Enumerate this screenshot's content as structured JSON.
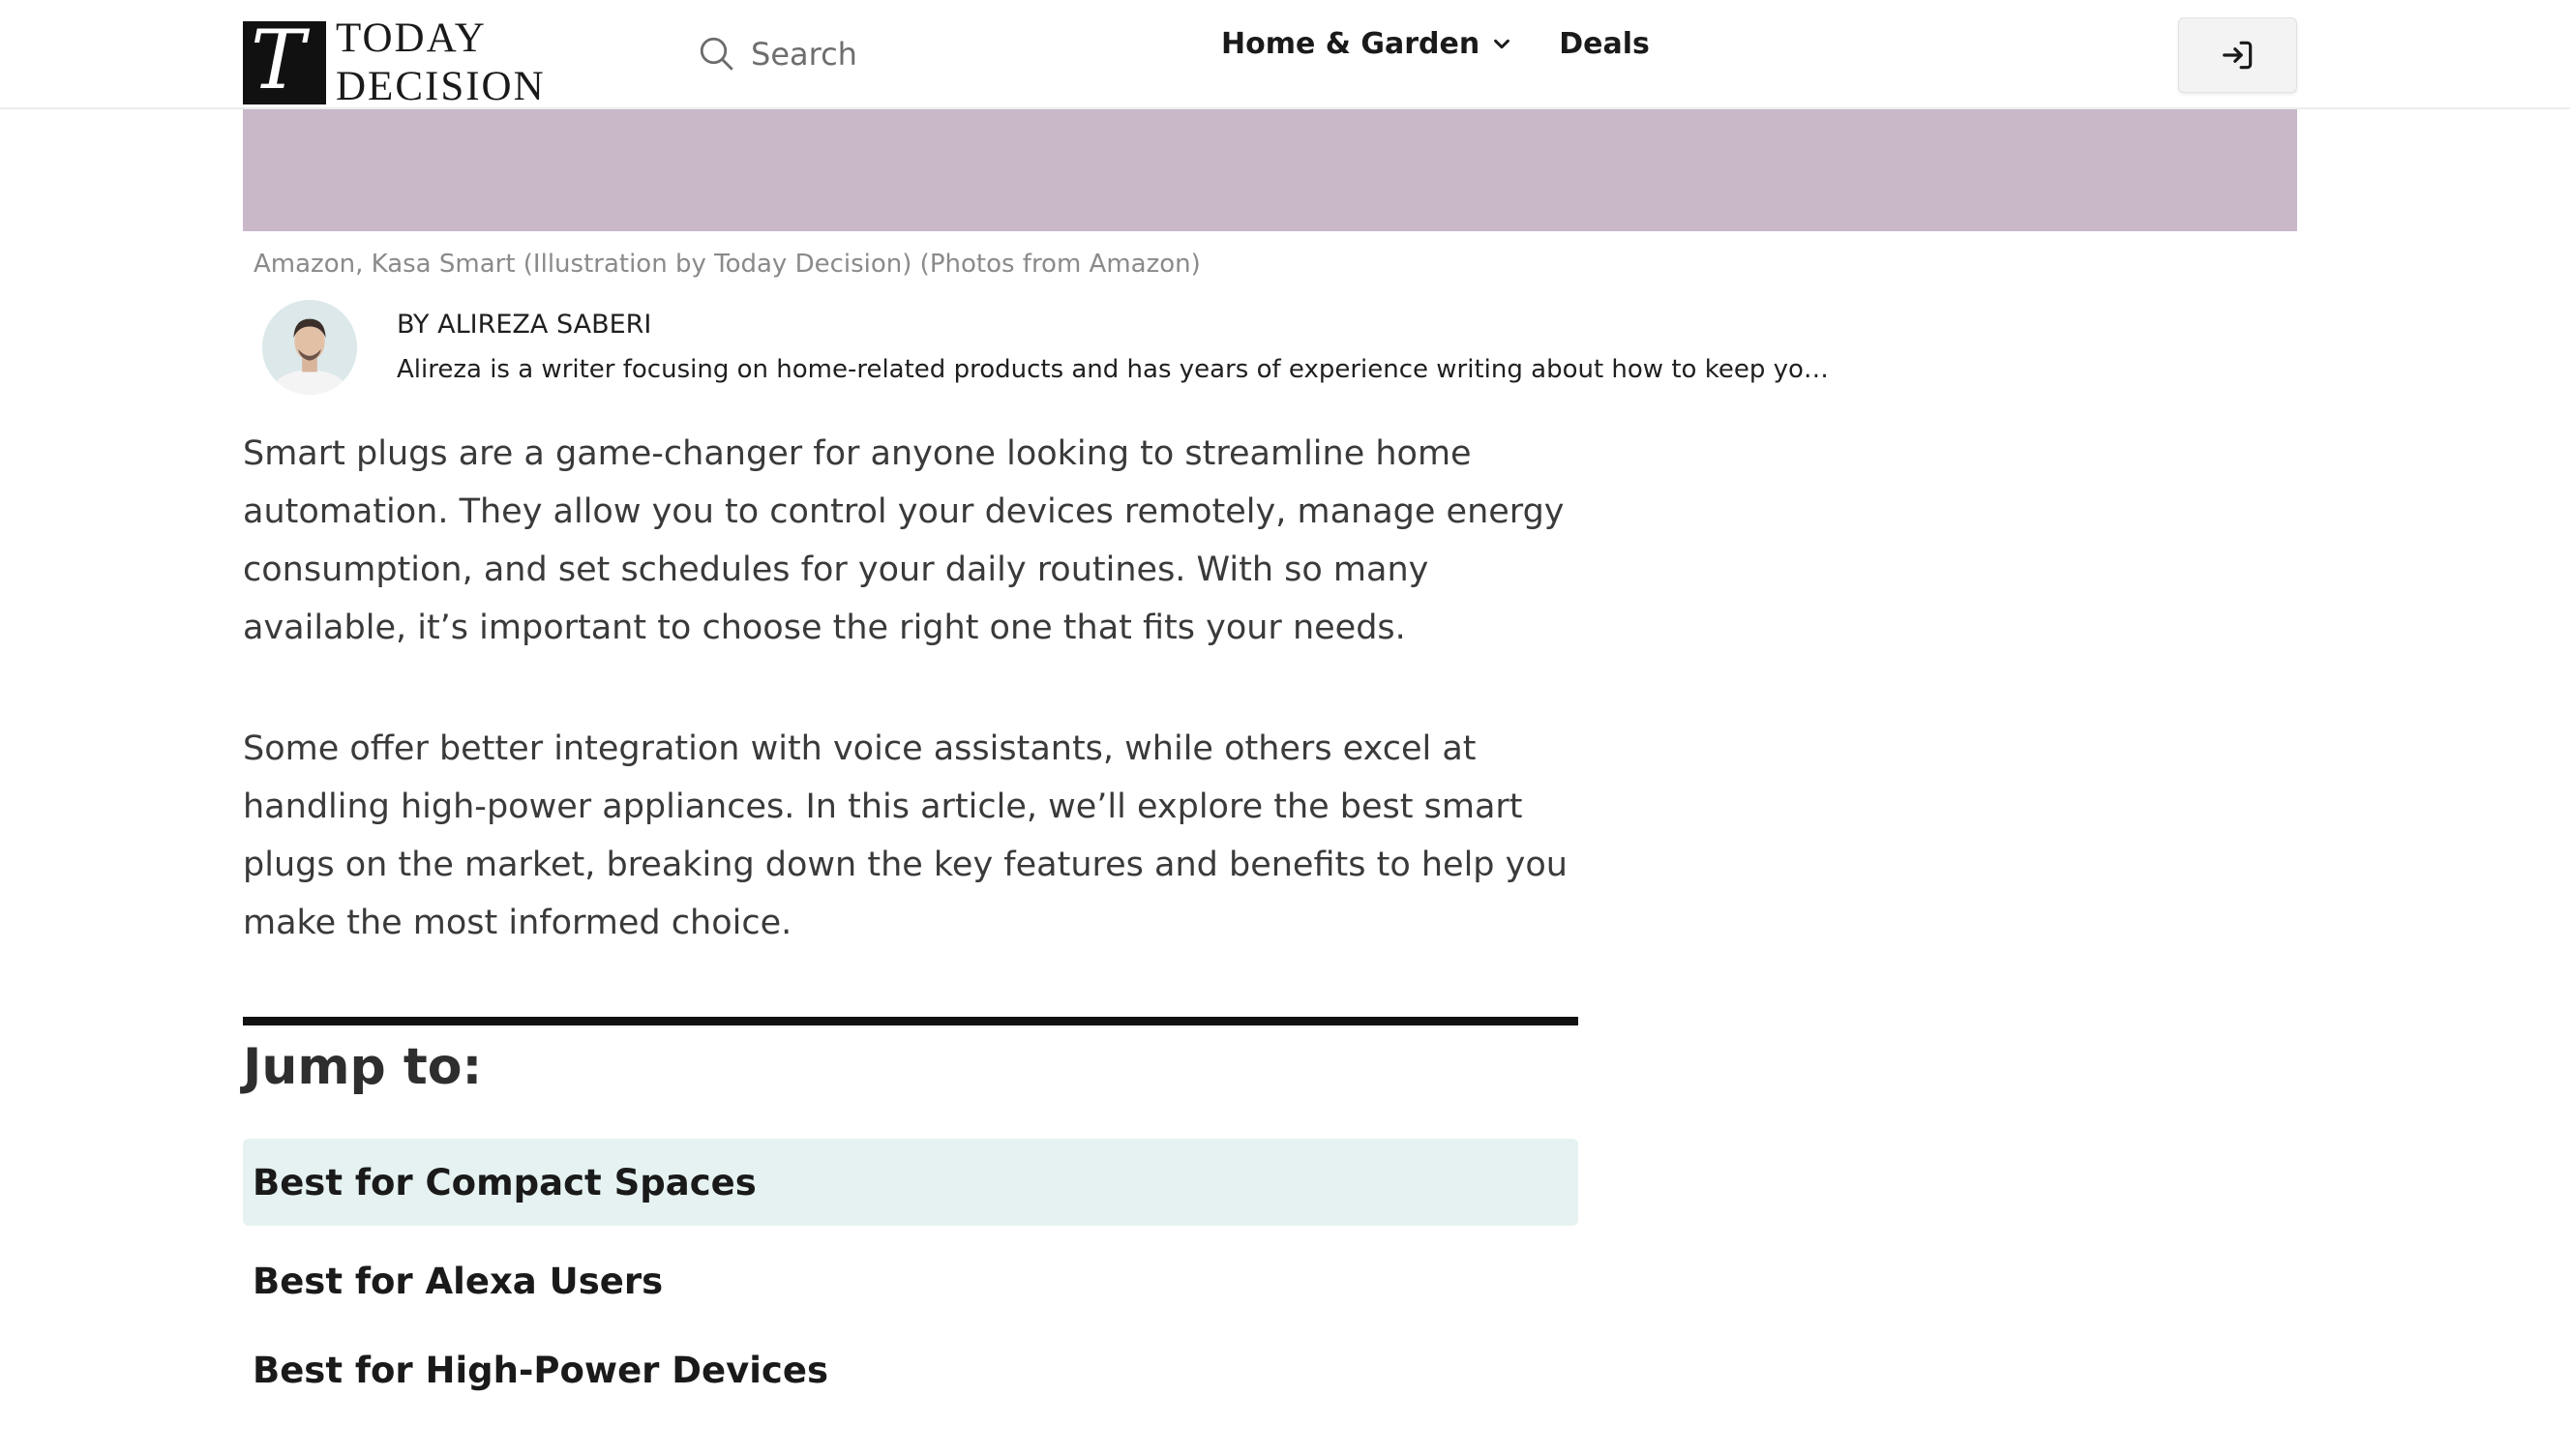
{
  "header": {
    "logo_mark": "T",
    "logo_line1": "TODAY",
    "logo_line2": "DECISION",
    "search_placeholder": "Search",
    "nav": [
      {
        "label": "Home & Garden",
        "icon": "chevron-down-icon"
      },
      {
        "label": "Deals"
      }
    ],
    "login_icon": "sign-in-icon"
  },
  "hero": {
    "color": "#c8b8c8",
    "caption": "Amazon, Kasa Smart (Illustration by Today Decision) (Photos from Amazon)"
  },
  "author": {
    "byline": "BY ALIREZA SABERI",
    "bio": "Alireza is a writer focusing on home-related products and has years of experience writing about how to keep your h..."
  },
  "article": {
    "paragraphs": [
      "Smart plugs are a game-changer for anyone looking to streamline home automation. They allow you to control your devices remotely, manage energy consumption, and set schedules for your daily routines. With so many available, it’s important to choose the right one that fits your needs.",
      "Some offer better integration with voice assistants, while others excel at handling high-power appliances. In this article, we’ll explore the best smart plugs on the market, breaking down the key features and benefits to help you make the most informed choice."
    ]
  },
  "toc": {
    "title": "Jump to:",
    "items": [
      {
        "label": "Best for Compact Spaces",
        "active": true
      },
      {
        "label": "Best for Alexa Users",
        "active": false
      },
      {
        "label": "Best for High-Power Devices",
        "active": false
      }
    ],
    "active_color": "#e5f2f1"
  }
}
